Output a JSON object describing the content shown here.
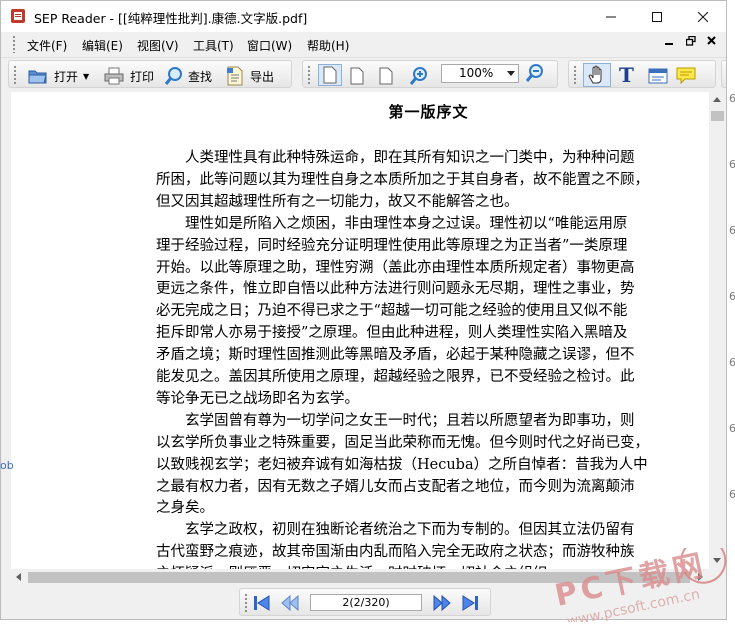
{
  "window": {
    "title": "SEP Reader - [[纯粹理性批判].康德.文字版.pdf]"
  },
  "menu": {
    "items": [
      "文件(F)",
      "编辑(E)",
      "视图(V)",
      "工具(T)",
      "窗口(W)",
      "帮助(H)"
    ]
  },
  "toolbar": {
    "open_label": "打开",
    "print_label": "打印",
    "find_label": "查找",
    "export_label": "导出",
    "zoom_value": "100%"
  },
  "document": {
    "heading": "第一版序文",
    "lines": [
      "　　人类理性具有此种特殊运命，即在其所有知识之一门类中，为种种问题",
      "所困，此等问题以其为理性自身之本质所加之于其自身者，故不能置之不顾，",
      "但又因其超越理性所有之一切能力，故又不能解答之也。",
      "　　理性如是所陷入之烦困，非由理性本身之过误。理性初以“唯能运用原",
      "理于经验过程，同时经验充分证明理性使用此等原理之为正当者”一类原理",
      "开始。以此等原理之助，理性穷溯（盖此亦由理性本质所规定者）事物更高",
      "更远之条件，惟立即自悟以此种方法进行则问题永无尽期，理性之事业，势",
      "必无完成之日；乃迫不得已求之于“超越一切可能之经验的使用且又似不能",
      "拒斥即常人亦易于接授”之原理。但由此种进程，则人类理性实陷入黑暗及",
      "矛盾之境；斯时理性固推测此等黑暗及矛盾，必起于某种隐藏之误谬，但不",
      "能发见之。盖因其所使用之原理，超越经验之限界，已不受经验之检讨。此",
      "等论争无已之战场即名为玄学。",
      "　　玄学固曾有尊为一切学问之女王一时代；且若以所愿望者为即事功，则",
      "以玄学所负事业之特殊重要，固足当此荣称而无愧。但今则时代之好尚已变，",
      "以致贱视玄学；老妇被弃诚有如海枯拔（Hecuba）之所自悼者：昔我为人中",
      "之最有权力者，因有无数之子婿儿女而占支配者之地位，而今则为流离颠沛",
      "之身矣。",
      "　　玄学之政权，初则在独断论者统治之下而为专制的。但因其立法仍留有",
      "古代蛮野之痕迹，故其帝国渐由内乱而陷入完全无政府之状态；而游牧种族",
      "之怀疑派，则厌恶一切安定之生活，时时破坏一切社会之组织。"
    ]
  },
  "navigation": {
    "page_indicator": "2(2/320)"
  },
  "watermark": {
    "brand": "PC下载网",
    "url": "www.pcsoft.com.cn"
  },
  "outside": {
    "right_marks": [
      "6",
      "6",
      "6",
      "6",
      "6",
      "6",
      "6"
    ],
    "left_mark": "ob"
  }
}
